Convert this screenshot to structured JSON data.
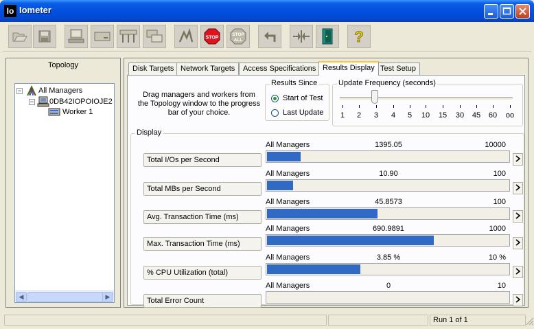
{
  "window": {
    "title": "Iometer",
    "app_icon_text": "Io"
  },
  "toolbar": {
    "buttons": [
      {
        "name": "open-icon"
      },
      {
        "name": "save-icon"
      },
      {
        "name": "new-manager-icon"
      },
      {
        "name": "new-disk-worker-icon"
      },
      {
        "name": "new-network-worker-icon"
      },
      {
        "name": "copy-worker-icon"
      },
      {
        "name": "start-tests-icon"
      },
      {
        "name": "stop-icon",
        "label": "STOP"
      },
      {
        "name": "stop-all-icon",
        "label_top": "STOP",
        "label_bottom": "ALL"
      },
      {
        "name": "reset-workers-icon"
      },
      {
        "name": "disconnect-workers-icon"
      },
      {
        "name": "exit-icon"
      },
      {
        "name": "help-icon",
        "label": "?"
      }
    ]
  },
  "topology": {
    "title": "Topology",
    "nodes": [
      {
        "label": "All Managers",
        "toggle": "−"
      },
      {
        "label": "0DB42IOPOIOJE2",
        "toggle": "−"
      },
      {
        "label": "Worker 1"
      }
    ]
  },
  "tabs": [
    "Disk Targets",
    "Network Targets",
    "Access Specifications",
    "Results Display",
    "Test Setup"
  ],
  "active_tab": "Results Display",
  "drag_instructions": "Drag managers and workers from the Topology window to the progress bar of your choice.",
  "results_since": {
    "title": "Results Since",
    "options": [
      "Start of Test",
      "Last Update"
    ],
    "selected": "Start of Test"
  },
  "update_frequency": {
    "title": "Update Frequency (seconds)",
    "ticks": [
      "1",
      "2",
      "3",
      "4",
      "5",
      "10",
      "15",
      "30",
      "45",
      "60",
      "oo"
    ],
    "selected": "3"
  },
  "display": {
    "title": "Display",
    "rows": [
      {
        "metric": "Total I/Os per Second",
        "source": "All Managers",
        "value": "1395.05",
        "max": "10000",
        "fraction": 0.1395
      },
      {
        "metric": "Total MBs per Second",
        "source": "All Managers",
        "value": "10.90",
        "max": "100",
        "fraction": 0.109
      },
      {
        "metric": "Avg. Transaction Time (ms)",
        "source": "All Managers",
        "value": "45.8573",
        "max": "100",
        "fraction": 0.4586
      },
      {
        "metric": "Max. Transaction Time (ms)",
        "source": "All Managers",
        "value": "690.9891",
        "max": "1000",
        "fraction": 0.691
      },
      {
        "metric": "% CPU Utilization (total)",
        "source": "All Managers",
        "value": "3.85 %",
        "max": "10 %",
        "fraction": 0.385
      },
      {
        "metric": "Total Error Count",
        "source": "All Managers",
        "value": "0",
        "max": "10",
        "fraction": 0
      }
    ]
  },
  "status": {
    "right_text": "Run 1 of 1"
  },
  "colors": {
    "bar_fill": "#316ac5",
    "title_bar": "#0350e0"
  }
}
